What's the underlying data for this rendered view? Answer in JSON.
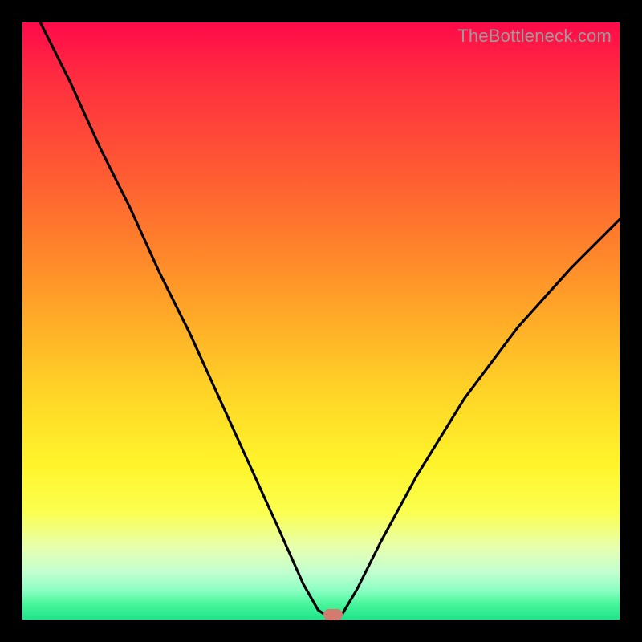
{
  "watermark": "TheBottleneck.com",
  "colors": {
    "frame": "#000000",
    "gradient_top": "#ff0a4a",
    "gradient_bottom": "#1fe38a",
    "curve": "#000000",
    "marker": "#d47b6f",
    "watermark_text": "#9c9c9c"
  },
  "chart_data": {
    "type": "line",
    "title": "",
    "xlabel": "",
    "ylabel": "",
    "xlim": [
      0,
      100
    ],
    "ylim": [
      0,
      100
    ],
    "grid": false,
    "legend": false,
    "series": [
      {
        "name": "bottleneck-curve",
        "x": [
          0,
          3,
          8,
          13,
          18,
          23,
          28,
          33,
          38,
          43,
          47,
          49.5,
          51,
          52,
          53.5,
          56,
          60,
          66,
          74,
          83,
          92,
          100
        ],
        "values": [
          122,
          100,
          90,
          79,
          69,
          58,
          48,
          37,
          26,
          15,
          6,
          1.6,
          0.6,
          0.6,
          0.8,
          5,
          13,
          24,
          37,
          49,
          59,
          67
        ]
      }
    ],
    "marker": {
      "x": 52,
      "y": 0.6
    },
    "background": "vertical-gradient-red-to-green"
  }
}
